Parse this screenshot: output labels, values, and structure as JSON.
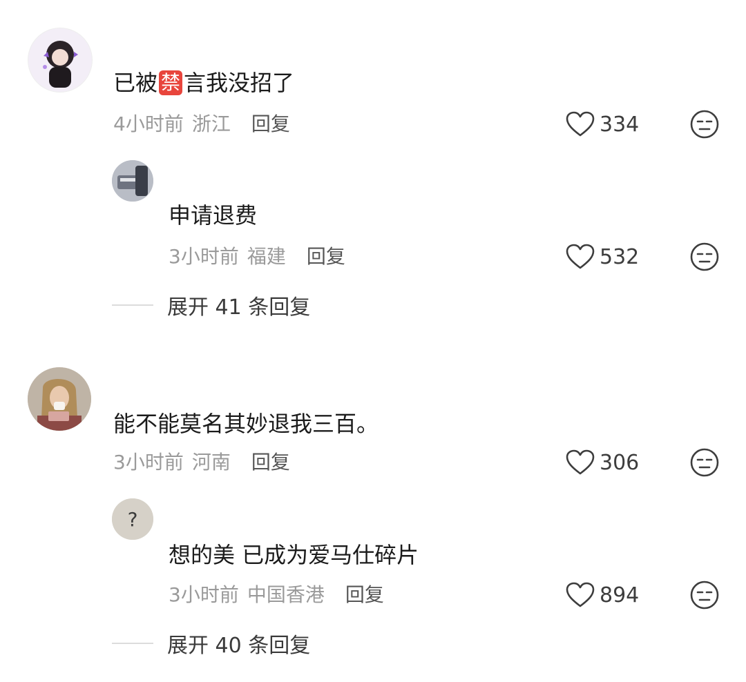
{
  "comments": [
    {
      "text_before": "已被",
      "banned_emoji": "禁",
      "text_after": "言我没招了",
      "time": "4小时前",
      "location": "浙江",
      "reply_label": "回复",
      "likes": "334",
      "replies": [
        {
          "text": "申请退费",
          "time": "3小时前",
          "location": "福建",
          "reply_label": "回复",
          "likes": "532"
        }
      ],
      "expand_label": "展开 41 条回复"
    },
    {
      "text": "能不能莫名其妙退我三百。",
      "time": "3小时前",
      "location": "河南",
      "reply_label": "回复",
      "likes": "306",
      "replies": [
        {
          "text": "想的美 已成为爱马仕碎片",
          "time": "3小时前",
          "location": "中国香港",
          "reply_label": "回复",
          "likes": "894",
          "avatar_glyph": "?"
        }
      ],
      "expand_label": "展开 40 条回复"
    }
  ],
  "colors": {
    "banned_badge": "#e8453c",
    "meta_text": "#9a9a9a",
    "icon": "#3d3d3d"
  }
}
